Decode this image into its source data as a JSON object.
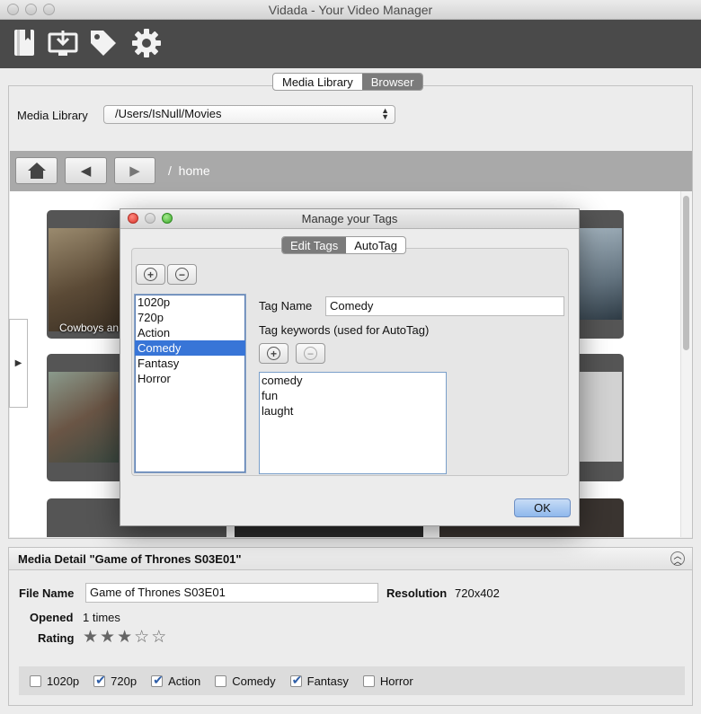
{
  "window": {
    "title": "Vidada - Your Video Manager"
  },
  "toolbar": {
    "icons": [
      "library-icon",
      "download-icon",
      "tag-icon",
      "gear-icon"
    ]
  },
  "tabs": {
    "items": [
      {
        "label": "Media Library",
        "selected": false
      },
      {
        "label": "Browser",
        "selected": true
      }
    ]
  },
  "library": {
    "label": "Media Library",
    "path": "/Users/IsNull/Movies"
  },
  "nav": {
    "path": "/  home"
  },
  "grid": {
    "cards": [
      {
        "caption": "Cowboys an"
      }
    ]
  },
  "dialog": {
    "title": "Manage your Tags",
    "tabs": [
      {
        "label": "Edit Tags",
        "selected": true
      },
      {
        "label": "AutoTag",
        "selected": false
      }
    ],
    "tags": [
      "1020p",
      "720p",
      "Action",
      "Comedy",
      "Fantasy",
      "Horror"
    ],
    "selected_tag": "Comedy",
    "tag_name_label": "Tag Name",
    "tag_name_value": "Comedy",
    "keywords_label": "Tag keywords (used for AutoTag)",
    "keywords": [
      "comedy",
      "fun",
      "laught"
    ],
    "ok_label": "OK"
  },
  "detail": {
    "title": "Media Detail \"Game of Thrones S03E01\"",
    "file_name_label": "File Name",
    "file_name_value": "Game of Thrones S03E01",
    "resolution_label": "Resolution",
    "resolution_value": "720x402",
    "opened_label": "Opened",
    "opened_value": "1 times",
    "rating_label": "Rating",
    "rating": 3,
    "rating_max": 5,
    "tag_checks": [
      {
        "label": "1020p",
        "checked": false
      },
      {
        "label": "720p",
        "checked": true
      },
      {
        "label": "Action",
        "checked": true
      },
      {
        "label": "Comedy",
        "checked": false
      },
      {
        "label": "Fantasy",
        "checked": true
      },
      {
        "label": "Horror",
        "checked": false
      }
    ]
  }
}
